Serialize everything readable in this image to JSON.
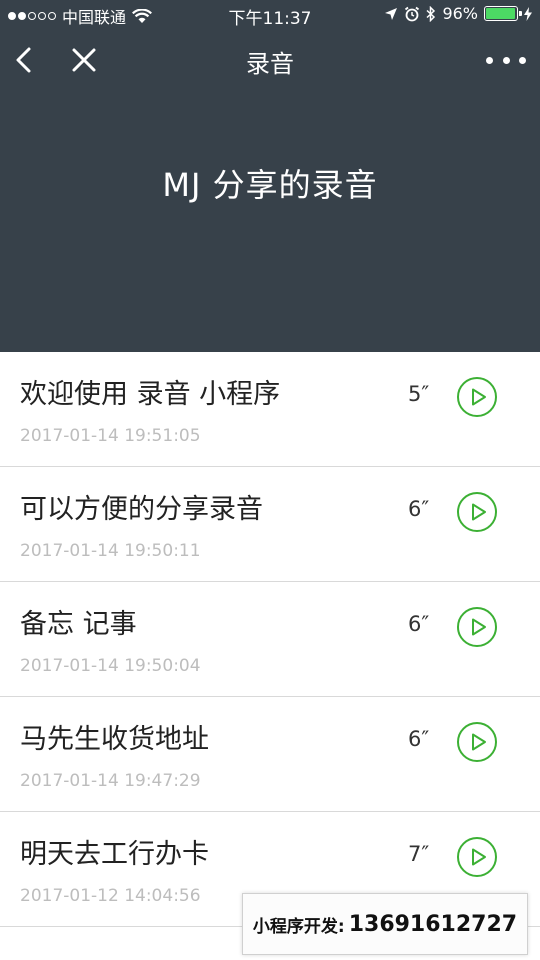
{
  "status_bar": {
    "carrier": "中国联通",
    "time": "下午11:37",
    "battery": "96%",
    "battery_level": 0.96,
    "signal_filled": 2,
    "signal_total": 5
  },
  "nav": {
    "title": "录音"
  },
  "hero": {
    "title": "MJ 分享的录音"
  },
  "recordings": [
    {
      "title": "欢迎使用 录音 小程序",
      "date": "2017-01-14 19:51:05",
      "duration": "5″"
    },
    {
      "title": "可以方便的分享录音",
      "date": "2017-01-14 19:50:11",
      "duration": "6″"
    },
    {
      "title": "备忘 记事",
      "date": "2017-01-14 19:50:04",
      "duration": "6″"
    },
    {
      "title": "马先生收货地址",
      "date": "2017-01-14 19:47:29",
      "duration": "6″"
    },
    {
      "title": "明天去工行办卡",
      "date": "2017-01-12 14:04:56",
      "duration": "7″"
    }
  ],
  "promo": {
    "label": "小程序开发:",
    "phone": "13691612727"
  },
  "colors": {
    "header_bg": "#37414a",
    "accent_green": "#3cb034",
    "date_gray": "#bdbdbd",
    "battery_green": "#4cd964"
  }
}
